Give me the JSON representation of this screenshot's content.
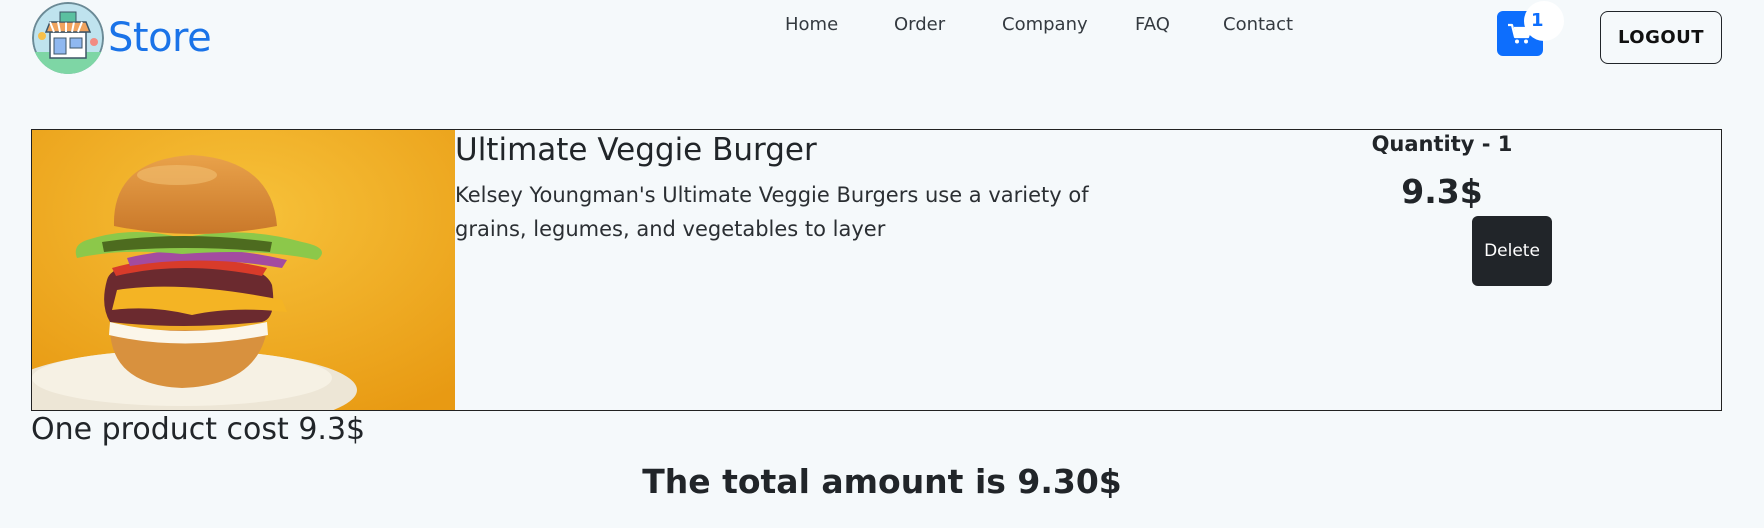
{
  "brand": {
    "name": "Store",
    "logo_icon": "storefront-icon"
  },
  "nav": {
    "items": [
      {
        "label": "Home"
      },
      {
        "label": "Order"
      },
      {
        "label": "Company"
      },
      {
        "label": "FAQ"
      },
      {
        "label": "Contact"
      }
    ],
    "cart_icon": "cart-icon",
    "cart_count": "1",
    "logout_label": "LOGOUT"
  },
  "product": {
    "title": "Ultimate Veggie Burger",
    "description": "Kelsey Youngman's Ultimate Veggie Burgers use a variety of grains, legumes, and vegetables to layer",
    "quantity_text": "Quantity - 1",
    "price_text": "9.3$",
    "delete_label": "Delete",
    "image_icon": "burger-photo"
  },
  "summary": {
    "one_product_text": "One product cost 9.3$",
    "total_text": "The total amount is 9.30$"
  },
  "colors": {
    "brand": "#1a73e8",
    "cart_button": "#0d6efd",
    "delete_button": "#212529",
    "background": "#f5f9fb"
  }
}
